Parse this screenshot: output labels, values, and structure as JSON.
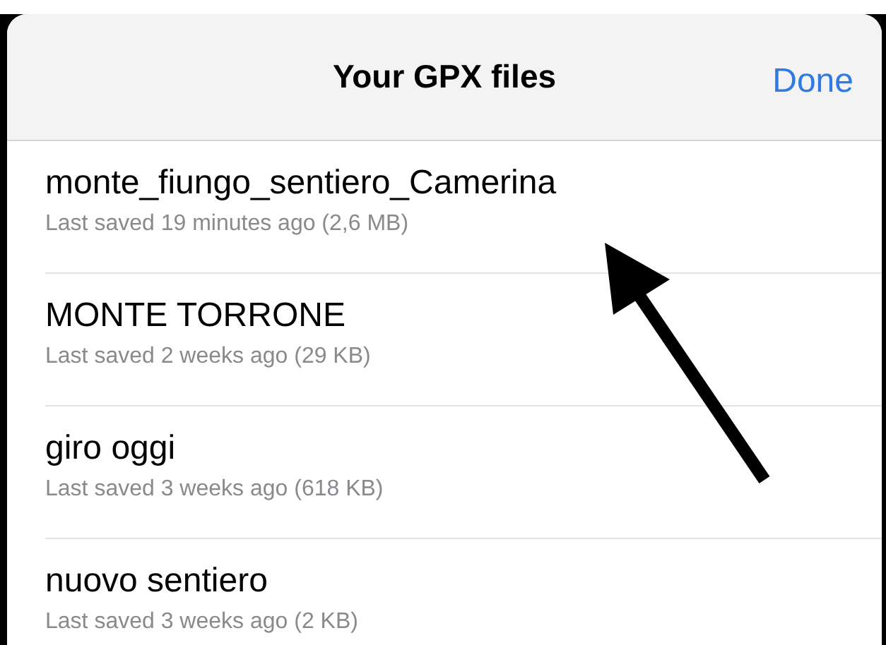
{
  "header": {
    "title": "Your GPX files",
    "done_button": "Done"
  },
  "files": [
    {
      "name": "monte_fiungo_sentiero_Camerina",
      "detail": "Last saved 19 minutes ago (2,6 MB)"
    },
    {
      "name": "MONTE TORRONE",
      "detail": "Last saved 2 weeks ago (29 KB)"
    },
    {
      "name": "giro oggi",
      "detail": "Last saved 3 weeks ago (618 KB)"
    },
    {
      "name": "nuovo sentiero",
      "detail": "Last saved 3 weeks ago (2 KB)"
    }
  ]
}
